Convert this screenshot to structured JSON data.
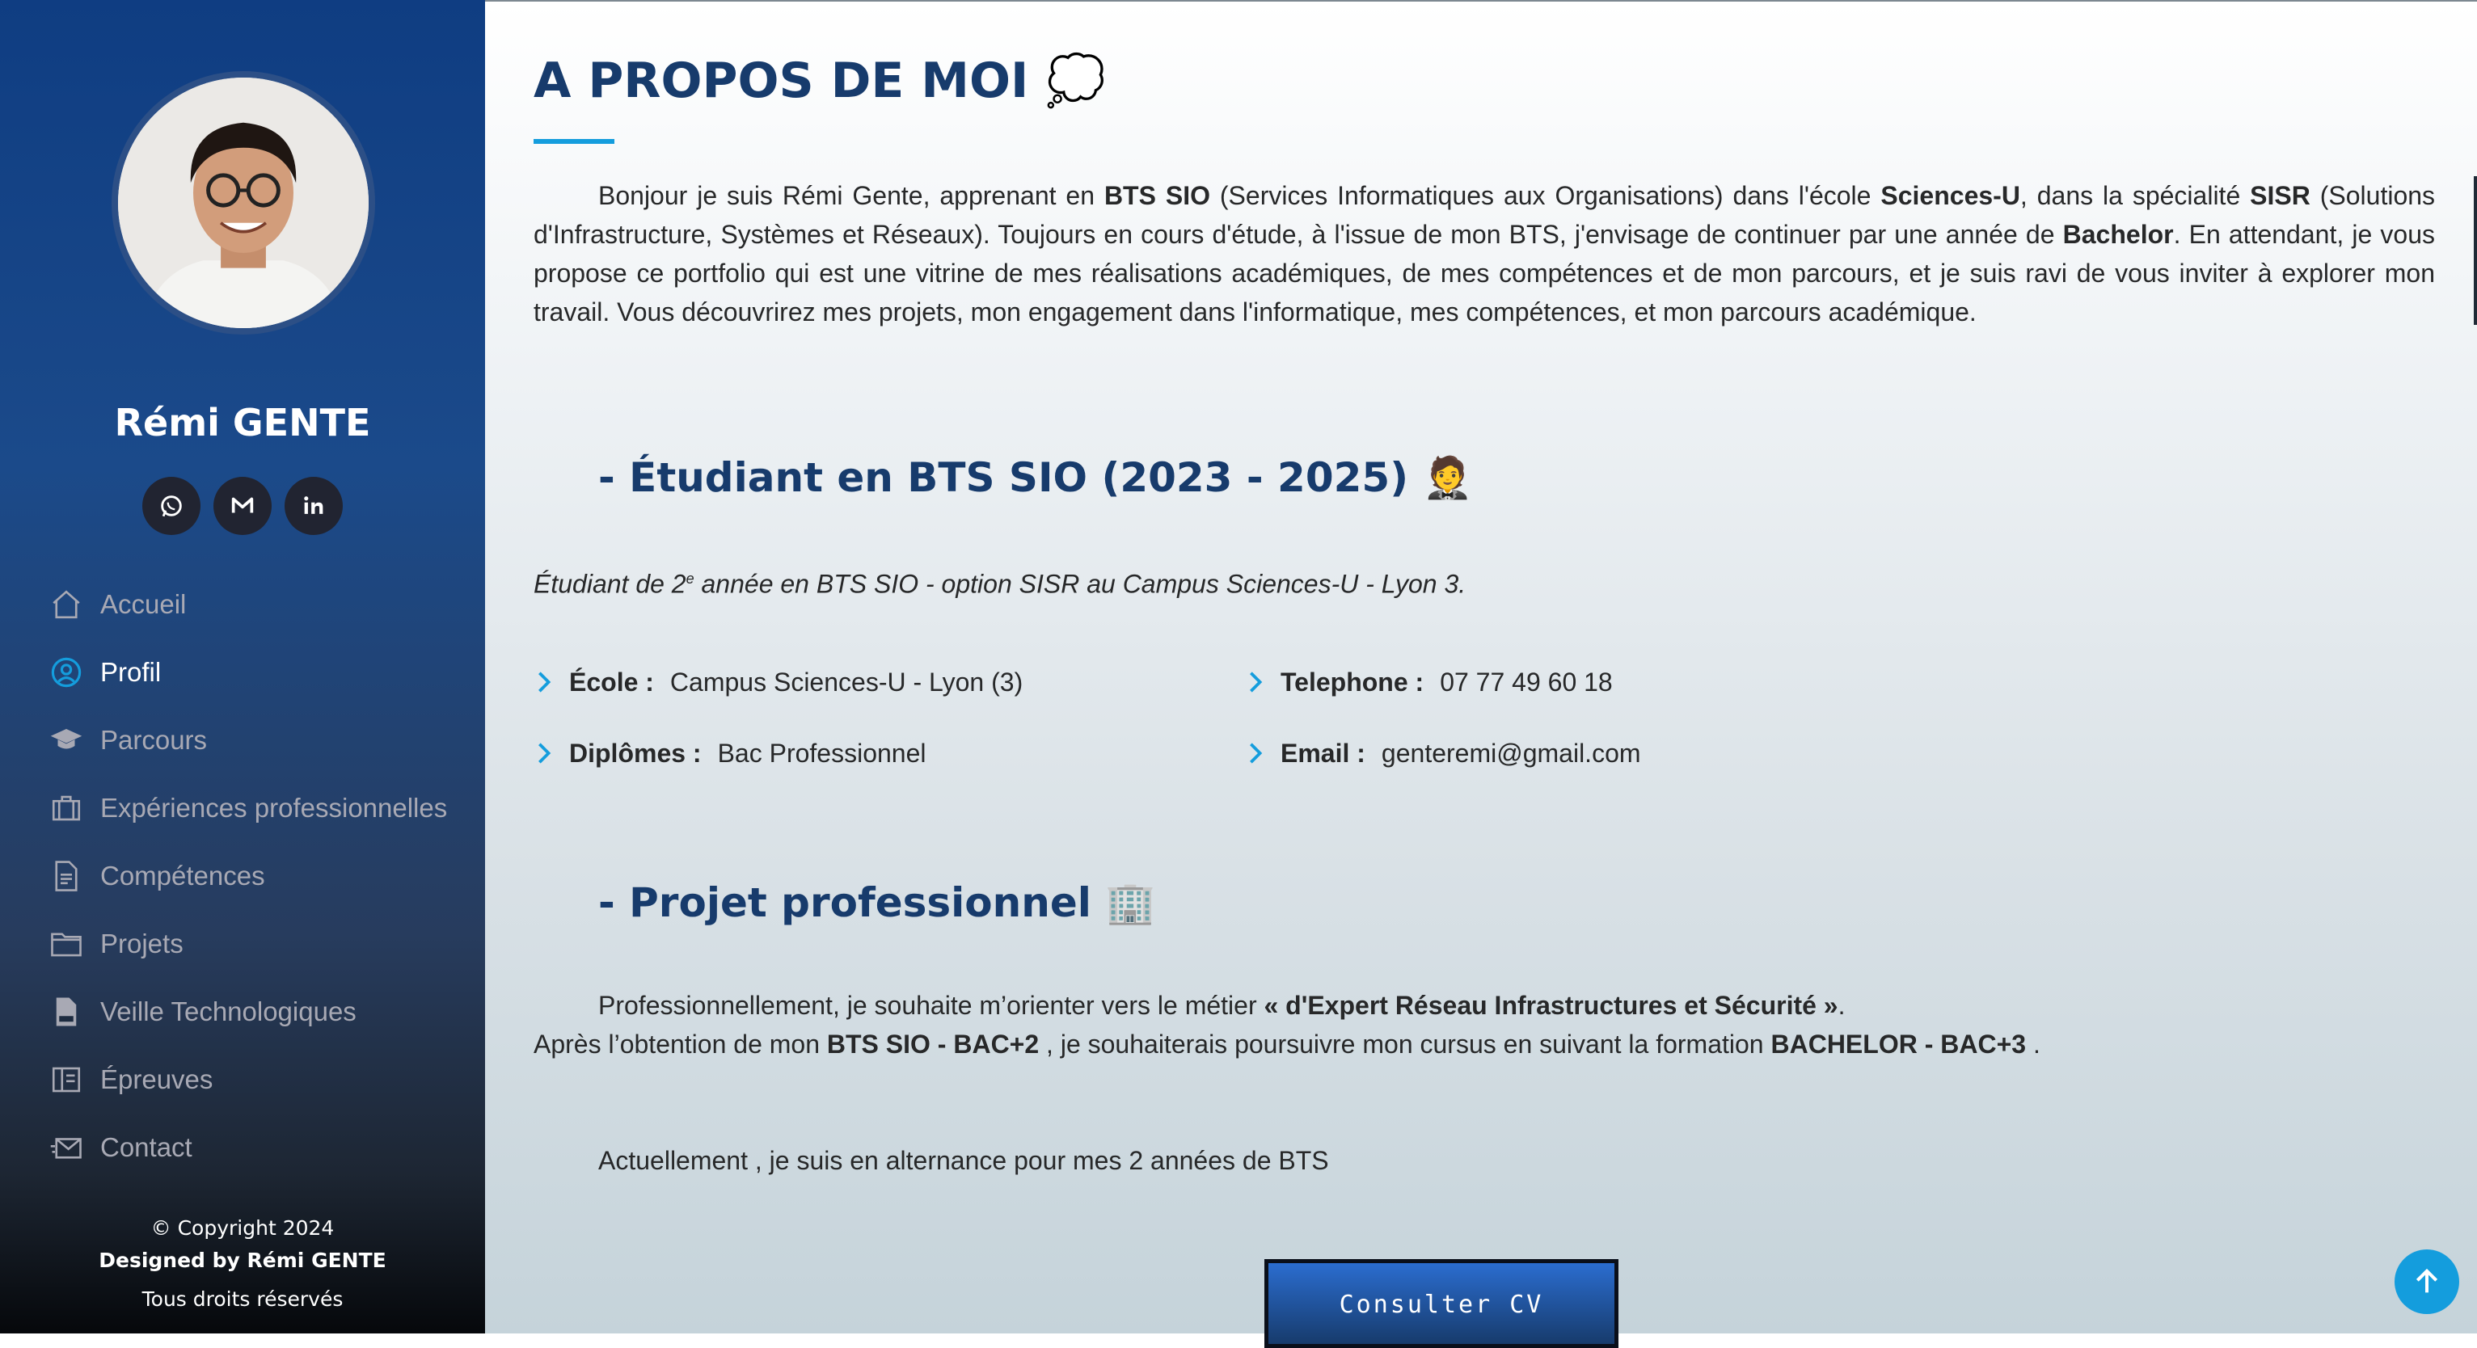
{
  "sidebar": {
    "name": "Rémi GENTE",
    "social": [
      {
        "icon": "whatsapp-icon"
      },
      {
        "icon": "gmail-icon"
      },
      {
        "icon": "linkedin-icon"
      }
    ],
    "nav": [
      {
        "label": "Accueil",
        "icon": "home-icon",
        "active": false
      },
      {
        "label": "Profil",
        "icon": "user-icon",
        "active": true
      },
      {
        "label": "Parcours",
        "icon": "graduation-cap-icon",
        "active": false
      },
      {
        "label": "Expériences professionnelles",
        "icon": "briefcase-icon",
        "active": false
      },
      {
        "label": "Compétences",
        "icon": "document-icon",
        "active": false
      },
      {
        "label": "Projets",
        "icon": "folder-icon",
        "active": false
      },
      {
        "label": "Veille Technologiques",
        "icon": "pdf-file-icon",
        "active": false
      },
      {
        "label": "Épreuves",
        "icon": "book-icon",
        "active": false
      },
      {
        "label": "Contact",
        "icon": "mail-icon",
        "active": false
      }
    ],
    "footer": {
      "copyright": "© Copyright 2024",
      "designed": "Designed by Rémi GENTE",
      "rights": "Tous droits réservés"
    }
  },
  "main": {
    "title": "A PROPOS DE MOI",
    "title_emoji": "💭",
    "intro": {
      "t1": "Bonjour je suis Rémi Gente, apprenant en ",
      "b1": "BTS SIO",
      "t2": " (Services Informatiques aux Organisations) dans l'école ",
      "b2": "Sciences-U",
      "t3": ", dans la spécialité ",
      "b3": "SISR",
      "t4": " (Solutions d'Infrastructure, Systèmes et Réseaux). Toujours en cours d'étude, à l'issue de mon BTS, j'envisage de continuer par une année de ",
      "b4": "Bachelor",
      "t5": ". En attendant, je vous propose ce portfolio qui est une vitrine de mes réalisations académiques, de mes compétences et de mon parcours, et je suis ravi de vous inviter à explorer mon travail. Vous découvrirez mes projets, mon engagement dans l'informatique, mes compétences, et mon parcours académique."
    },
    "student": {
      "title": "- Étudiant en BTS SIO (2023 - 2025)",
      "emoji": "🤵",
      "desc_before": "Étudiant de 2",
      "desc_sup": "e",
      "desc_after": " année en BTS SIO - option SISR au Campus Sciences-U - Lyon 3."
    },
    "info": {
      "school_label": "École :",
      "school_value": "Campus Sciences-U - Lyon (3)",
      "diploma_label": "Diplômes :",
      "diploma_value": "Bac Professionnel",
      "phone_label": "Telephone :",
      "phone_value": "07 77 49 60 18",
      "email_label": "Email :",
      "email_value": "genteremi@gmail.com"
    },
    "project": {
      "title": "- Projet professionnel",
      "emoji": "🏢",
      "p1_text": "Professionnellement, je souhaite m’orienter vers le métier ",
      "p1_bold": "« d'Expert Réseau Infrastructures et Sécurité »",
      "p1_end": ".",
      "p2_text1": "Après l’obtention de mon ",
      "p2_bold1": "BTS SIO - BAC+2",
      "p2_text2": " , je souhaiterais poursuivre mon cursus en suivant la formation ",
      "p2_bold2": "BACHELOR - BAC+3",
      "p2_end": " .",
      "current": "Actuellement , je suis en alternance pour mes 2 années de BTS"
    },
    "cv_button": "Consulter CV"
  },
  "colors": {
    "accent": "#149ddd",
    "heading": "#173b6c",
    "sidebar_top": "#0f3d82",
    "nav_inactive": "#a8a9b4"
  }
}
